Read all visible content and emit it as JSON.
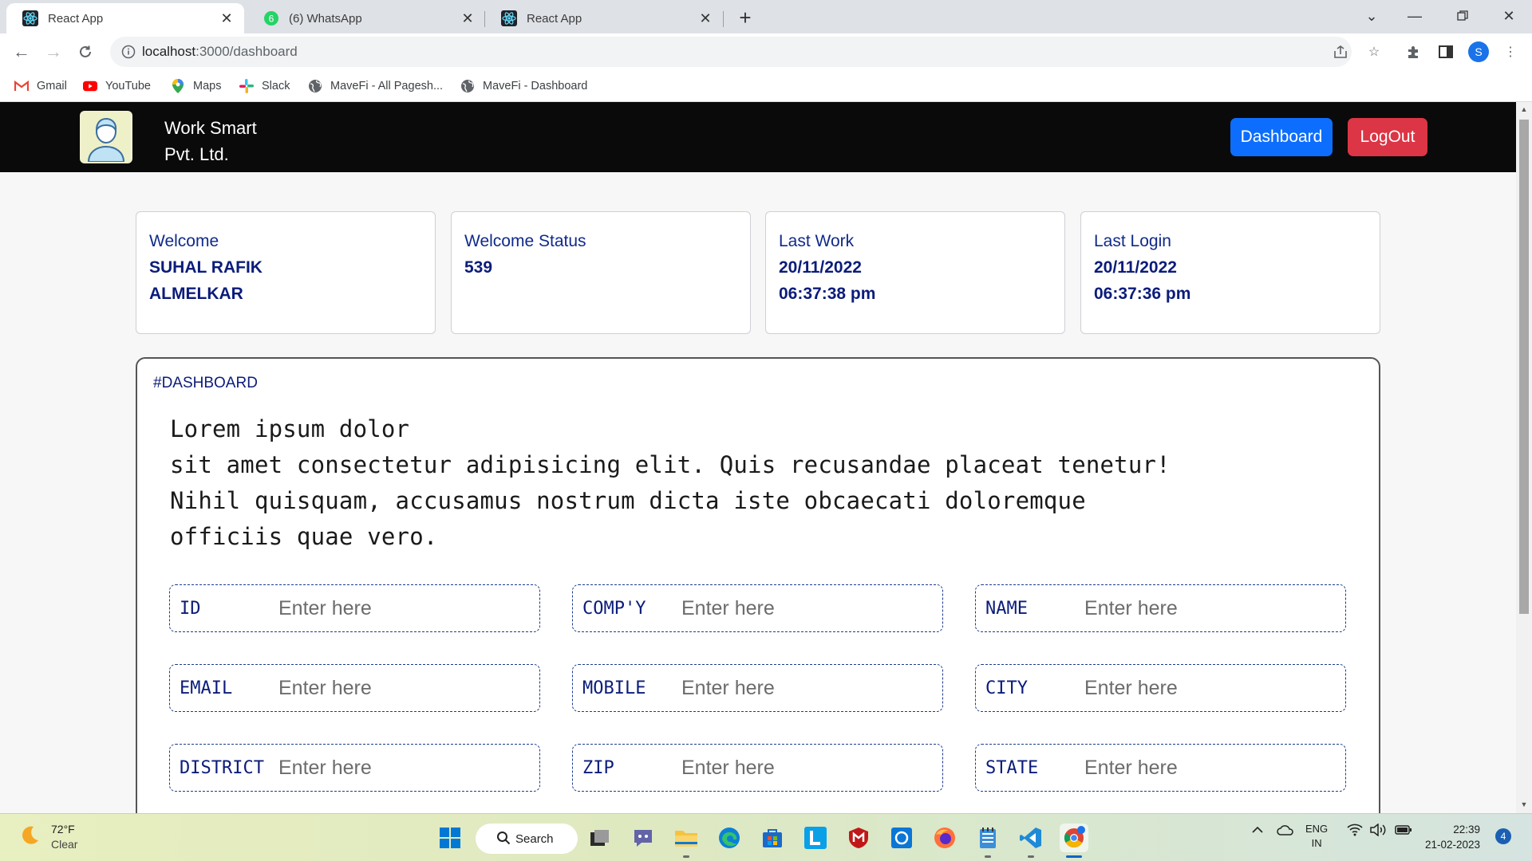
{
  "browser": {
    "tabs": [
      {
        "title": "React App",
        "active": true,
        "icon": "react-icon"
      },
      {
        "title": "(6) WhatsApp",
        "active": false,
        "icon": "whatsapp-icon",
        "badge": "6"
      },
      {
        "title": "React App",
        "active": false,
        "icon": "react-icon"
      }
    ],
    "address": {
      "host": "localhost",
      "path": ":3000/dashboard"
    },
    "profile_initial": "S",
    "bookmarks": [
      {
        "label": "Gmail",
        "icon": "gmail-icon"
      },
      {
        "label": "YouTube",
        "icon": "youtube-icon"
      },
      {
        "label": "Maps",
        "icon": "maps-icon"
      },
      {
        "label": "Slack",
        "icon": "slack-icon"
      },
      {
        "label": "MaveFi - All Pagesh...",
        "icon": "globe-icon"
      },
      {
        "label": "MaveFi - Dashboard",
        "icon": "globe-icon"
      }
    ]
  },
  "app": {
    "brand": {
      "line1": "Work Smart",
      "line2": "Pvt. Ltd."
    },
    "nav": {
      "dashboard_label": "Dashboard",
      "logout_label": "LogOut"
    },
    "cards": [
      {
        "label": "Welcome",
        "value": "SUHAL RAFIK\nALMELKAR"
      },
      {
        "label": "Welcome Status",
        "value": "539"
      },
      {
        "label": "Last Work",
        "value": "20/11/2022\n06:37:38 pm"
      },
      {
        "label": "Last Login",
        "value": "20/11/2022\n06:37:36 pm"
      }
    ],
    "panel": {
      "tag": "#DASHBOARD",
      "text": "Lorem ipsum dolor\nsit amet consectetur adipisicing elit. Quis recusandae placeat tenetur!\nNihil quisquam, accusamus nostrum dicta iste obcaecati doloremque\nofficiis quae vero."
    },
    "fields": [
      {
        "label": "ID",
        "placeholder": "Enter here"
      },
      {
        "label": "COMP'Y",
        "placeholder": "Enter here"
      },
      {
        "label": "NAME",
        "placeholder": "Enter here"
      },
      {
        "label": "EMAIL",
        "placeholder": "Enter here"
      },
      {
        "label": "MOBILE",
        "placeholder": "Enter here"
      },
      {
        "label": "CITY",
        "placeholder": "Enter here"
      },
      {
        "label": "DISTRICT",
        "placeholder": "Enter here"
      },
      {
        "label": "ZIP",
        "placeholder": "Enter here"
      },
      {
        "label": "STATE",
        "placeholder": "Enter here"
      }
    ]
  },
  "taskbar": {
    "weather": {
      "temp": "72°F",
      "condition": "Clear"
    },
    "search_label": "Search",
    "language": {
      "line1": "ENG",
      "line2": "IN"
    },
    "clock": {
      "time": "22:39",
      "date": "21-02-2023"
    },
    "notification_count": "4"
  },
  "colors": {
    "primary": "#0d6efd",
    "danger": "#dc3545",
    "navy_text": "#0b1c7a",
    "navbar": "#0a0a0a"
  }
}
